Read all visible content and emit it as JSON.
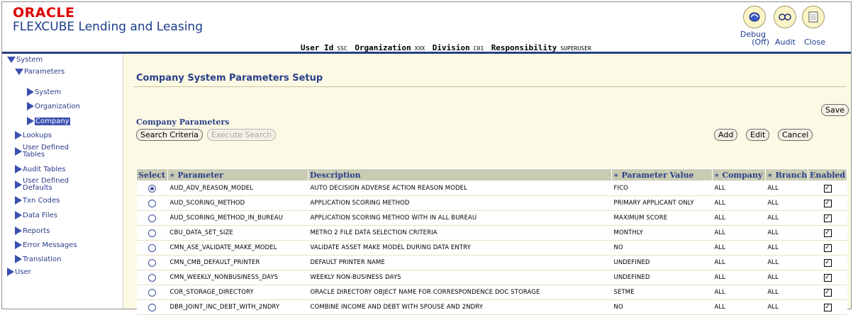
{
  "header": {
    "brand": "ORACLE",
    "product": "FLEXCUBE Lending and Leasing",
    "user_id_label": "User Id",
    "user_id": "SSC",
    "org_label": "Organization",
    "org": "XXX",
    "division_label": "Division",
    "division": "C01",
    "resp_label": "Responsibility",
    "resp": "SUPERUSER",
    "debug_label": "Debug",
    "debug_state": "(Off)",
    "audit_label": "Audit",
    "close_label": "Close"
  },
  "sidebar": {
    "system": "System",
    "parameters": "Parameters",
    "items_sub": [
      "System",
      "Organization",
      "Company"
    ],
    "items": [
      "Lookups",
      "User Defined Tables",
      "Audit Tables",
      "User Defined Defaults",
      "Txn Codes",
      "Data Files",
      "Reports",
      "Error Messages",
      "Translation"
    ],
    "user": "User"
  },
  "main": {
    "title": "Company System Parameters Setup",
    "section": "Company Parameters",
    "save": "Save",
    "search_criteria": "Search Criteria",
    "execute_search": "Execute Search",
    "add": "Add",
    "edit": "Edit",
    "cancel": "Cancel",
    "columns": [
      "Select",
      "Parameter",
      "Description",
      "Parameter Value",
      "Company",
      "Branch",
      "Enabled"
    ],
    "rows": [
      {
        "selected": true,
        "param": "AUD_ADV_REASON_MODEL",
        "desc": "AUTO DECISION ADVERSE ACTION REASON MODEL",
        "value": "FICO",
        "company": "ALL",
        "branch": "ALL",
        "enabled": true
      },
      {
        "selected": false,
        "param": "AUD_SCORING_METHOD",
        "desc": "APPLICATION SCORING METHOD",
        "value": "PRIMARY APPLICANT ONLY",
        "company": "ALL",
        "branch": "ALL",
        "enabled": true
      },
      {
        "selected": false,
        "param": "AUD_SCORING_METHOD_IN_BUREAU",
        "desc": "APPLICATION SCORING METHOD WITH IN ALL BUREAU",
        "value": "MAXIMUM SCORE",
        "company": "ALL",
        "branch": "ALL",
        "enabled": true
      },
      {
        "selected": false,
        "param": "CBU_DATA_SET_SIZE",
        "desc": "METRO 2 FILE DATA SELECTION CRITERIA",
        "value": "MONTHLY",
        "company": "ALL",
        "branch": "ALL",
        "enabled": true
      },
      {
        "selected": false,
        "param": "CMN_ASE_VALIDATE_MAKE_MODEL",
        "desc": "VALIDATE ASSET MAKE MODEL DURING DATA ENTRY",
        "value": "NO",
        "company": "ALL",
        "branch": "ALL",
        "enabled": true
      },
      {
        "selected": false,
        "param": "CMN_CMB_DEFAULT_PRINTER",
        "desc": "DEFAULT PRINTER NAME",
        "value": "UNDEFINED",
        "company": "ALL",
        "branch": "ALL",
        "enabled": true
      },
      {
        "selected": false,
        "param": "CMN_WEEKLY_NONBUSINESS_DAYS",
        "desc": "WEEKLY NON-BUSINESS DAYS",
        "value": "UNDEFINED",
        "company": "ALL",
        "branch": "ALL",
        "enabled": true
      },
      {
        "selected": false,
        "param": "COR_STORAGE_DIRECTORY",
        "desc": "ORACLE DIRECTORY OBJECT NAME FOR CORRESPONDENCE DOC STORAGE",
        "value": "SETME",
        "company": "ALL",
        "branch": "ALL",
        "enabled": true
      },
      {
        "selected": false,
        "param": "DBR_JOINT_INC_DEBT_WITH_2NDRY",
        "desc": "COMBINE INCOME AND DEBT WITH SPOUSE AND 2NDRY",
        "value": "NO",
        "company": "ALL",
        "branch": "ALL",
        "enabled": true
      }
    ]
  }
}
